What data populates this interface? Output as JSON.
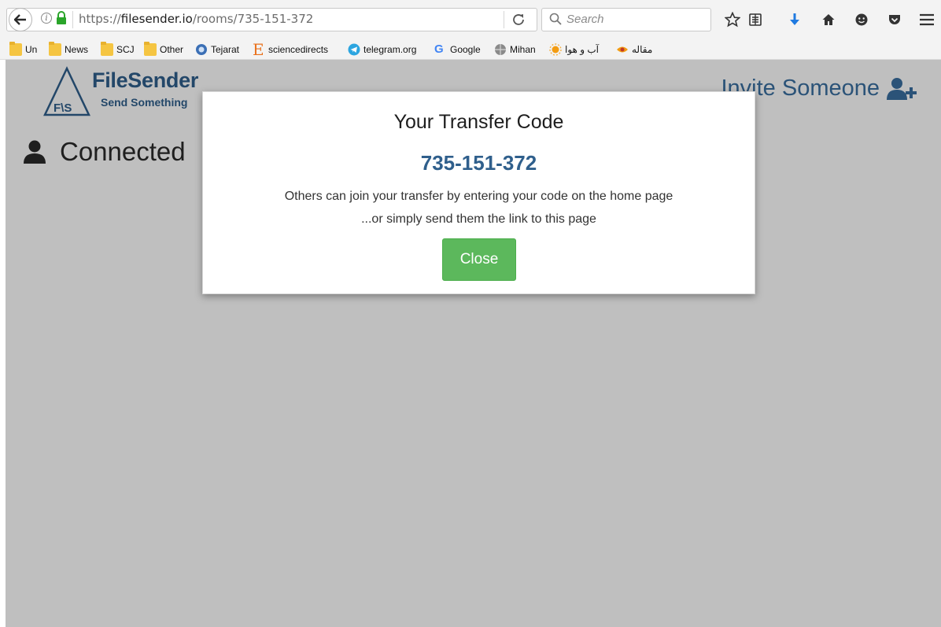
{
  "browser": {
    "url_scheme": "https://",
    "url_host": "filesender.io",
    "url_path": "/rooms/735-151-372",
    "search_placeholder": "Search",
    "bookmarks": [
      {
        "label": "Un",
        "icon": "folder-icon"
      },
      {
        "label": "News",
        "icon": "folder-icon"
      },
      {
        "label": "SCJ",
        "icon": "folder-icon"
      },
      {
        "label": "Other",
        "icon": "folder-icon"
      },
      {
        "label": "Tejarat",
        "icon": "globe-icon"
      },
      {
        "label": "sciencedirects",
        "icon": "elsevier-icon"
      },
      {
        "label": "telegram.org",
        "icon": "telegram-icon"
      },
      {
        "label": "Google",
        "icon": "google-icon"
      },
      {
        "label": "Mihan",
        "icon": "globe-icon"
      },
      {
        "label": "آب و هوا",
        "icon": "sun-icon"
      },
      {
        "label": "مقاله",
        "icon": "eye-icon"
      }
    ]
  },
  "page": {
    "brand_name": "FileSender",
    "brand_tag": "Send Something",
    "logo_letters": "F\\S",
    "invite_label": "Invite Someone",
    "connected_label": "Connected"
  },
  "modal": {
    "title": "Your Transfer Code",
    "code": "735-151-372",
    "line1": "Others can join your transfer by entering your code on the home page",
    "line2": "...or simply send them the link to this page",
    "close_label": "Close"
  },
  "colors": {
    "brand": "#2f5f8c",
    "close_button": "#5cb85c"
  }
}
